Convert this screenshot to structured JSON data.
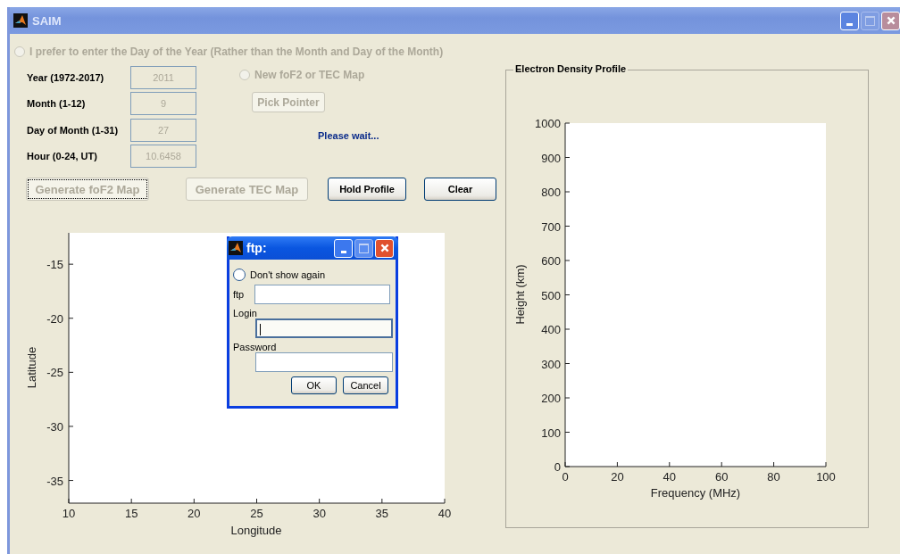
{
  "window": {
    "title": "SAIM"
  },
  "day_of_year_option": {
    "label": "I prefer to enter the Day of the Year (Rather than the Month and Day of the Month)",
    "selected": false,
    "disabled": true
  },
  "fields": [
    {
      "label": "Year (1972-2017)",
      "value": "2011",
      "disabled": true
    },
    {
      "label": "Month (1-12)",
      "value": "9",
      "disabled": true
    },
    {
      "label": "Day of Month (1-31)",
      "value": "27",
      "disabled": true
    },
    {
      "label": "Hour (0-24, UT)",
      "value": "10.6458",
      "disabled": true
    }
  ],
  "map_option": {
    "label": "New foF2 or TEC Map",
    "selected": false,
    "disabled": true
  },
  "pick_pointer": {
    "label": "Pick Pointer",
    "disabled": true
  },
  "status": "Please wait...",
  "buttons": [
    {
      "label": "Generate foF2 Map",
      "disabled": true,
      "focused": true
    },
    {
      "label": "Generate TEC Map",
      "disabled": true,
      "focused": false
    },
    {
      "label": "Hold Profile",
      "disabled": false,
      "focused": false
    },
    {
      "label": "Clear",
      "disabled": false,
      "focused": false
    }
  ],
  "map_axes": {
    "chart_data": {
      "type": "line",
      "xlabel": "Longitude",
      "ylabel": "Latitude",
      "xlim": [
        10,
        40
      ],
      "ylim": [
        -37.1,
        -12.1
      ],
      "xticks": [
        10,
        15,
        20,
        25,
        30,
        35,
        40
      ],
      "yticks": [
        -15,
        -20,
        -25,
        -30,
        -35
      ]
    }
  },
  "profile_panel": {
    "title": "Electron Density Profile",
    "chart_data": {
      "type": "line",
      "xlabel": "Frequency (MHz)",
      "ylabel": "Height (km)",
      "xlim": [
        0,
        100
      ],
      "ylim": [
        0,
        1000
      ],
      "xticks": [
        0,
        20,
        40,
        60,
        80,
        100
      ],
      "yticks": [
        0,
        100,
        200,
        300,
        400,
        500,
        600,
        700,
        800,
        900,
        1000
      ]
    }
  },
  "dialog": {
    "title": "ftp:",
    "option": {
      "label": "Don't show again",
      "selected": false
    },
    "fields": [
      {
        "label": "ftp",
        "focused": false
      },
      {
        "label": "Login",
        "focused": true
      },
      {
        "label": "Password",
        "focused": false
      }
    ],
    "buttons": [
      {
        "label": "OK"
      },
      {
        "label": "Cancel"
      }
    ]
  }
}
